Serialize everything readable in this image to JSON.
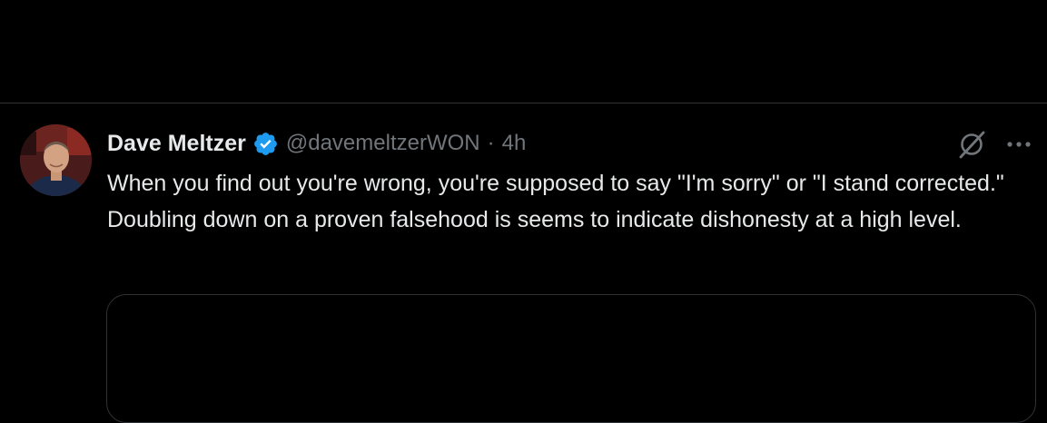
{
  "tweet": {
    "display_name": "Dave Meltzer",
    "handle": "@davemeltzerWON",
    "separator": "·",
    "time": "4h",
    "text": "When you find out you're wrong, you're supposed to say \"I'm sorry\" or \"I stand corrected.\"  Doubling down on a proven falsehood is seems to indicate dishonesty at a high level.",
    "verified": true
  },
  "icons": {
    "verified": "verified-badge-icon",
    "grok": "grok-icon",
    "more": "more-options-icon"
  },
  "colors": {
    "background": "#000000",
    "primary_text": "#e7e9ea",
    "secondary_text": "#71767b",
    "border": "#2f3336",
    "verified_blue": "#1d9bf0"
  }
}
